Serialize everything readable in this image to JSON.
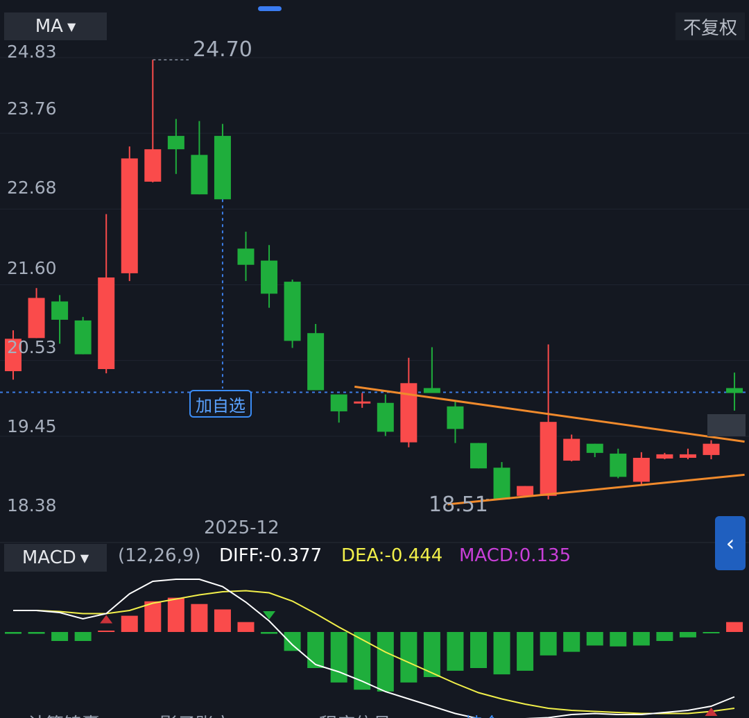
{
  "header": {
    "indicator_label": "MA",
    "adjust_label": "不复权"
  },
  "price_axis": {
    "ticks": [
      "24.83",
      "23.76",
      "22.68",
      "21.60",
      "20.53",
      "19.45",
      "18.38"
    ]
  },
  "annotations": {
    "high_label": "24.70",
    "low_label": "18.51",
    "date_label": "2025-12",
    "add_watchlist": "加自选"
  },
  "macd": {
    "indicator_label": "MACD",
    "params": "(12,26,9)",
    "diff_text": "DIFF:-0.377",
    "dea_text": "DEA:-0.444",
    "macd_text": "MACD:0.135"
  },
  "bottom_tabs": [
    "计算锦囊",
    "影子账户",
    "程序信号",
    "持仓"
  ],
  "colors": {
    "up": "#fa4b4b",
    "down": "#1fae3c",
    "diff_line": "#ffffff",
    "dea_line": "#f2f04a",
    "trendline": "#f08a2c",
    "background": "#141821"
  },
  "chart_data": {
    "type": "candlestick",
    "price_range": [
      18.38,
      24.83
    ],
    "last_price": 19.98,
    "candles": [
      {
        "o": 20.28,
        "c": 20.74,
        "h": 20.86,
        "l": 20.16,
        "dir": "up"
      },
      {
        "o": 20.75,
        "c": 21.32,
        "h": 21.46,
        "l": 20.75,
        "dir": "up"
      },
      {
        "o": 21.27,
        "c": 21.01,
        "h": 21.36,
        "l": 20.67,
        "dir": "down"
      },
      {
        "o": 21.0,
        "c": 20.52,
        "h": 21.05,
        "l": 20.52,
        "dir": "down"
      },
      {
        "o": 20.31,
        "c": 21.61,
        "h": 22.51,
        "l": 20.25,
        "dir": "up"
      },
      {
        "o": 21.67,
        "c": 23.3,
        "h": 23.47,
        "l": 21.56,
        "dir": "up"
      },
      {
        "o": 22.97,
        "c": 23.43,
        "h": 24.7,
        "l": 22.96,
        "dir": "up"
      },
      {
        "o": 23.62,
        "c": 23.43,
        "h": 23.86,
        "l": 23.08,
        "dir": "down"
      },
      {
        "o": 23.35,
        "c": 22.79,
        "h": 23.83,
        "l": 22.79,
        "dir": "down"
      },
      {
        "o": 23.62,
        "c": 22.72,
        "h": 23.79,
        "l": 22.72,
        "dir": "down"
      },
      {
        "o": 22.02,
        "c": 21.79,
        "h": 22.26,
        "l": 21.56,
        "dir": "down"
      },
      {
        "o": 21.85,
        "c": 21.38,
        "h": 22.07,
        "l": 21.18,
        "dir": "down"
      },
      {
        "o": 21.55,
        "c": 20.71,
        "h": 21.58,
        "l": 20.61,
        "dir": "down"
      },
      {
        "o": 20.82,
        "c": 20.01,
        "h": 20.95,
        "l": 20.01,
        "dir": "down"
      },
      {
        "o": 19.95,
        "c": 19.71,
        "h": 19.95,
        "l": 19.55,
        "dir": "down"
      },
      {
        "o": 19.83,
        "c": 19.85,
        "h": 19.97,
        "l": 19.76,
        "dir": "up"
      },
      {
        "o": 19.83,
        "c": 19.42,
        "h": 19.95,
        "l": 19.36,
        "dir": "down"
      },
      {
        "o": 19.27,
        "c": 20.11,
        "h": 20.47,
        "l": 19.2,
        "dir": "up"
      },
      {
        "o": 20.04,
        "c": 19.97,
        "h": 20.62,
        "l": 19.97,
        "dir": "down"
      },
      {
        "o": 19.78,
        "c": 19.46,
        "h": 19.85,
        "l": 19.26,
        "dir": "down"
      },
      {
        "o": 19.26,
        "c": 18.9,
        "h": 19.26,
        "l": 18.9,
        "dir": "down"
      },
      {
        "o": 18.91,
        "c": 18.46,
        "h": 18.99,
        "l": 18.46,
        "dir": "down"
      },
      {
        "o": 18.51,
        "c": 18.65,
        "h": 18.65,
        "l": 18.51,
        "dir": "up"
      },
      {
        "o": 18.51,
        "c": 19.56,
        "h": 20.66,
        "l": 18.46,
        "dir": "up"
      },
      {
        "o": 19.01,
        "c": 19.32,
        "h": 19.38,
        "l": 19.0,
        "dir": "up"
      },
      {
        "o": 19.25,
        "c": 19.12,
        "h": 19.25,
        "l": 19.06,
        "dir": "down"
      },
      {
        "o": 19.11,
        "c": 18.78,
        "h": 19.18,
        "l": 18.76,
        "dir": "down"
      },
      {
        "o": 18.71,
        "c": 19.05,
        "h": 19.13,
        "l": 18.67,
        "dir": "up"
      },
      {
        "o": 19.04,
        "c": 19.1,
        "h": 19.12,
        "l": 19.03,
        "dir": "up"
      },
      {
        "o": 19.05,
        "c": 19.1,
        "h": 19.18,
        "l": 19.03,
        "dir": "up"
      },
      {
        "o": 19.09,
        "c": 19.25,
        "h": 19.3,
        "l": 19.03,
        "dir": "up"
      },
      {
        "o": 19.97,
        "c": 20.04,
        "h": 20.26,
        "l": 19.72,
        "dir": "down"
      }
    ],
    "macd_hist": [
      -0.02,
      -0.02,
      -0.1,
      -0.1,
      0.01,
      0.18,
      0.34,
      0.38,
      0.31,
      0.25,
      0.11,
      -0.02,
      -0.21,
      -0.4,
      -0.56,
      -0.64,
      -0.66,
      -0.56,
      -0.5,
      -0.43,
      -0.4,
      -0.47,
      -0.43,
      -0.26,
      -0.22,
      -0.15,
      -0.16,
      -0.15,
      -0.1,
      -0.06,
      -0.01,
      0.11
    ],
    "diff": [
      0.34,
      0.34,
      0.32,
      0.26,
      0.31,
      0.5,
      0.62,
      0.64,
      0.64,
      0.57,
      0.42,
      0.24,
      0.01,
      -0.18,
      -0.25,
      -0.34,
      -0.44,
      -0.51,
      -0.58,
      -0.65,
      -0.7,
      -0.71,
      -0.7,
      -0.69,
      -0.66,
      -0.65,
      -0.66,
      -0.66,
      -0.64,
      -0.62,
      -0.58,
      -0.49
    ],
    "dea": [
      0.34,
      0.34,
      0.33,
      0.31,
      0.31,
      0.34,
      0.41,
      0.45,
      0.49,
      0.52,
      0.53,
      0.51,
      0.43,
      0.31,
      0.18,
      0.06,
      -0.06,
      -0.16,
      -0.26,
      -0.36,
      -0.45,
      -0.51,
      -0.56,
      -0.6,
      -0.62,
      -0.63,
      -0.64,
      -0.65,
      -0.65,
      -0.65,
      -0.63,
      -0.6
    ],
    "signals": [
      {
        "index": 4,
        "type": "golden-cross",
        "color": "#c9333a"
      },
      {
        "index": 11,
        "type": "death-cross",
        "color": "#1fae3c"
      },
      {
        "index": 30,
        "type": "golden-cross",
        "color": "#c9333a"
      }
    ],
    "trendlines": [
      {
        "from": {
          "index": 15,
          "price": 20.06
        },
        "to": {
          "index": 32,
          "price": 19.28
        }
      },
      {
        "from": {
          "index": 19,
          "price": 18.39
        },
        "to": {
          "index": 32,
          "price": 18.81
        }
      }
    ]
  }
}
